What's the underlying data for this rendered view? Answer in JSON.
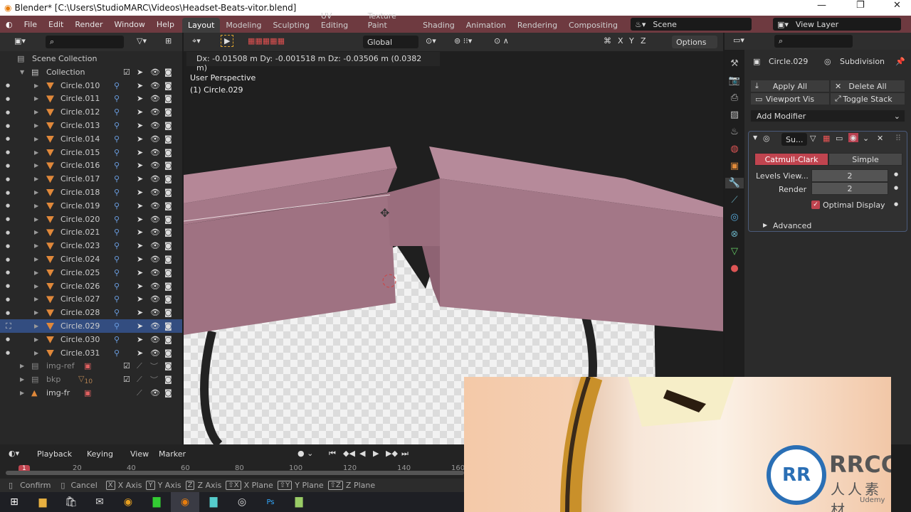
{
  "window": {
    "title": "Blender* [C:\\Users\\StudioMARC\\Videos\\Headset-Beats-vitor.blend]"
  },
  "menu": [
    "File",
    "Edit",
    "Render",
    "Window",
    "Help"
  ],
  "workspaces": [
    "Layout",
    "Modeling",
    "Sculpting",
    "UV Editing",
    "Texture Paint",
    "Shading",
    "Animation",
    "Rendering",
    "Compositing"
  ],
  "scene": "Scene",
  "view_layer": "View Layer",
  "viewport": {
    "orientation": "Global",
    "options": "Options",
    "axes": [
      "X",
      "Y",
      "Z"
    ],
    "transform_readout": "Dx: -0.01508 m   Dy: -0.001518 m  Dz: -0.03506 m (0.0382 m)",
    "view_name": "User Perspective",
    "object_label": "(1) Circle.029"
  },
  "outliner": {
    "scene_collection": "Scene Collection",
    "collection": "Collection",
    "objects": [
      "Circle.010",
      "Circle.011",
      "Circle.012",
      "Circle.013",
      "Circle.014",
      "Circle.015",
      "Circle.016",
      "Circle.017",
      "Circle.018",
      "Circle.019",
      "Circle.020",
      "Circle.021",
      "Circle.023",
      "Circle.024",
      "Circle.025",
      "Circle.026",
      "Circle.027",
      "Circle.028",
      "Circle.029",
      "Circle.030",
      "Circle.031"
    ],
    "selected": "Circle.029",
    "extra": [
      {
        "label": "img-ref"
      },
      {
        "label": "bkp",
        "badge": "10"
      },
      {
        "label": "img-fr"
      }
    ]
  },
  "properties": {
    "object": "Circle.029",
    "modifier": "Subdivision",
    "apply_all": "Apply All",
    "delete_all": "Delete All",
    "viewport_vis": "Viewport Vis",
    "toggle_stack": "Toggle Stack",
    "add_modifier": "Add Modifier",
    "mod_name": "Su...",
    "catmull": "Catmull-Clark",
    "simple": "Simple",
    "levels_label": "Levels View...",
    "levels_value": "2",
    "render_label": "Render",
    "render_value": "2",
    "optimal": "Optimal Display",
    "advanced": "Advanced"
  },
  "timeline": {
    "playback": "Playback",
    "keying": "Keying",
    "view": "View",
    "marker": "Marker",
    "current_frame": "1",
    "ticks": [
      "20",
      "40",
      "60",
      "80",
      "100",
      "120",
      "140",
      "160"
    ]
  },
  "status": [
    {
      "key": "X",
      "label": "X Axis"
    },
    {
      "key": "Y",
      "label": "Y Axis"
    },
    {
      "key": "Z",
      "label": "Z Axis"
    },
    {
      "key": "⇧X",
      "label": "X Plane"
    },
    {
      "key": "⇧Y",
      "label": "Y Plane"
    },
    {
      "key": "⇧Z",
      "label": "Z Plane"
    }
  ],
  "status_mouse": {
    "confirm": "Confirm",
    "cancel": "Cancel"
  },
  "watermark": {
    "text": "RRCG",
    "sub": "人人素材",
    "small": "Udemy"
  },
  "colors": {
    "accent": "#c0444f",
    "menubar": "#6e3a40",
    "selection": "#334d80",
    "mesh": "#a77a8a"
  }
}
